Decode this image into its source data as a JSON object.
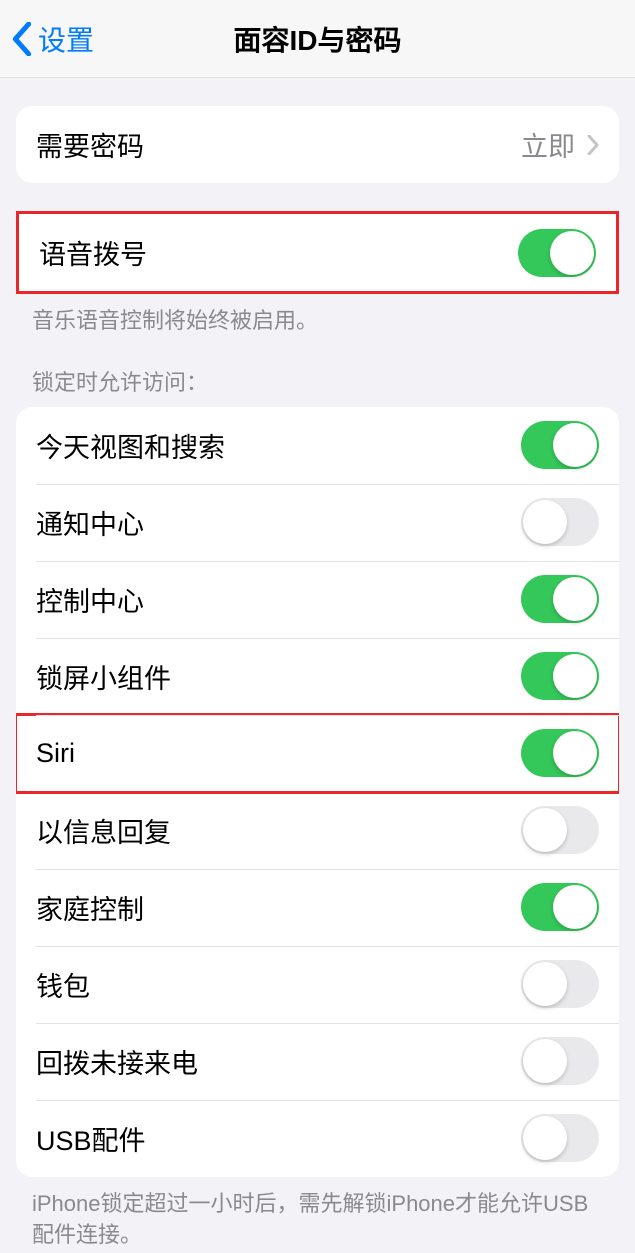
{
  "navbar": {
    "back_label": "设置",
    "title": "面容ID与密码"
  },
  "passcode_group": {
    "require_passcode": {
      "label": "需要密码",
      "value": "立即"
    }
  },
  "voice_dial": {
    "label": "语音拨号",
    "footer": "音乐语音控制将始终被启用。"
  },
  "lock_access": {
    "header": "锁定时允许访问：",
    "today_view": {
      "label": "今天视图和搜索",
      "on": true
    },
    "notifications": {
      "label": "通知中心",
      "on": false
    },
    "control_center": {
      "label": "控制中心",
      "on": true
    },
    "widgets": {
      "label": "锁屏小组件",
      "on": true
    },
    "siri": {
      "label": "Siri",
      "on": true
    },
    "reply_message": {
      "label": "以信息回复",
      "on": false
    },
    "home_control": {
      "label": "家庭控制",
      "on": true
    },
    "wallet": {
      "label": "钱包",
      "on": false
    },
    "return_calls": {
      "label": "回拨未接来电",
      "on": false
    },
    "usb": {
      "label": "USB配件",
      "on": false
    }
  },
  "usb_footer": "iPhone锁定超过一小时后，需先解锁iPhone才能允许USB配件连接。"
}
